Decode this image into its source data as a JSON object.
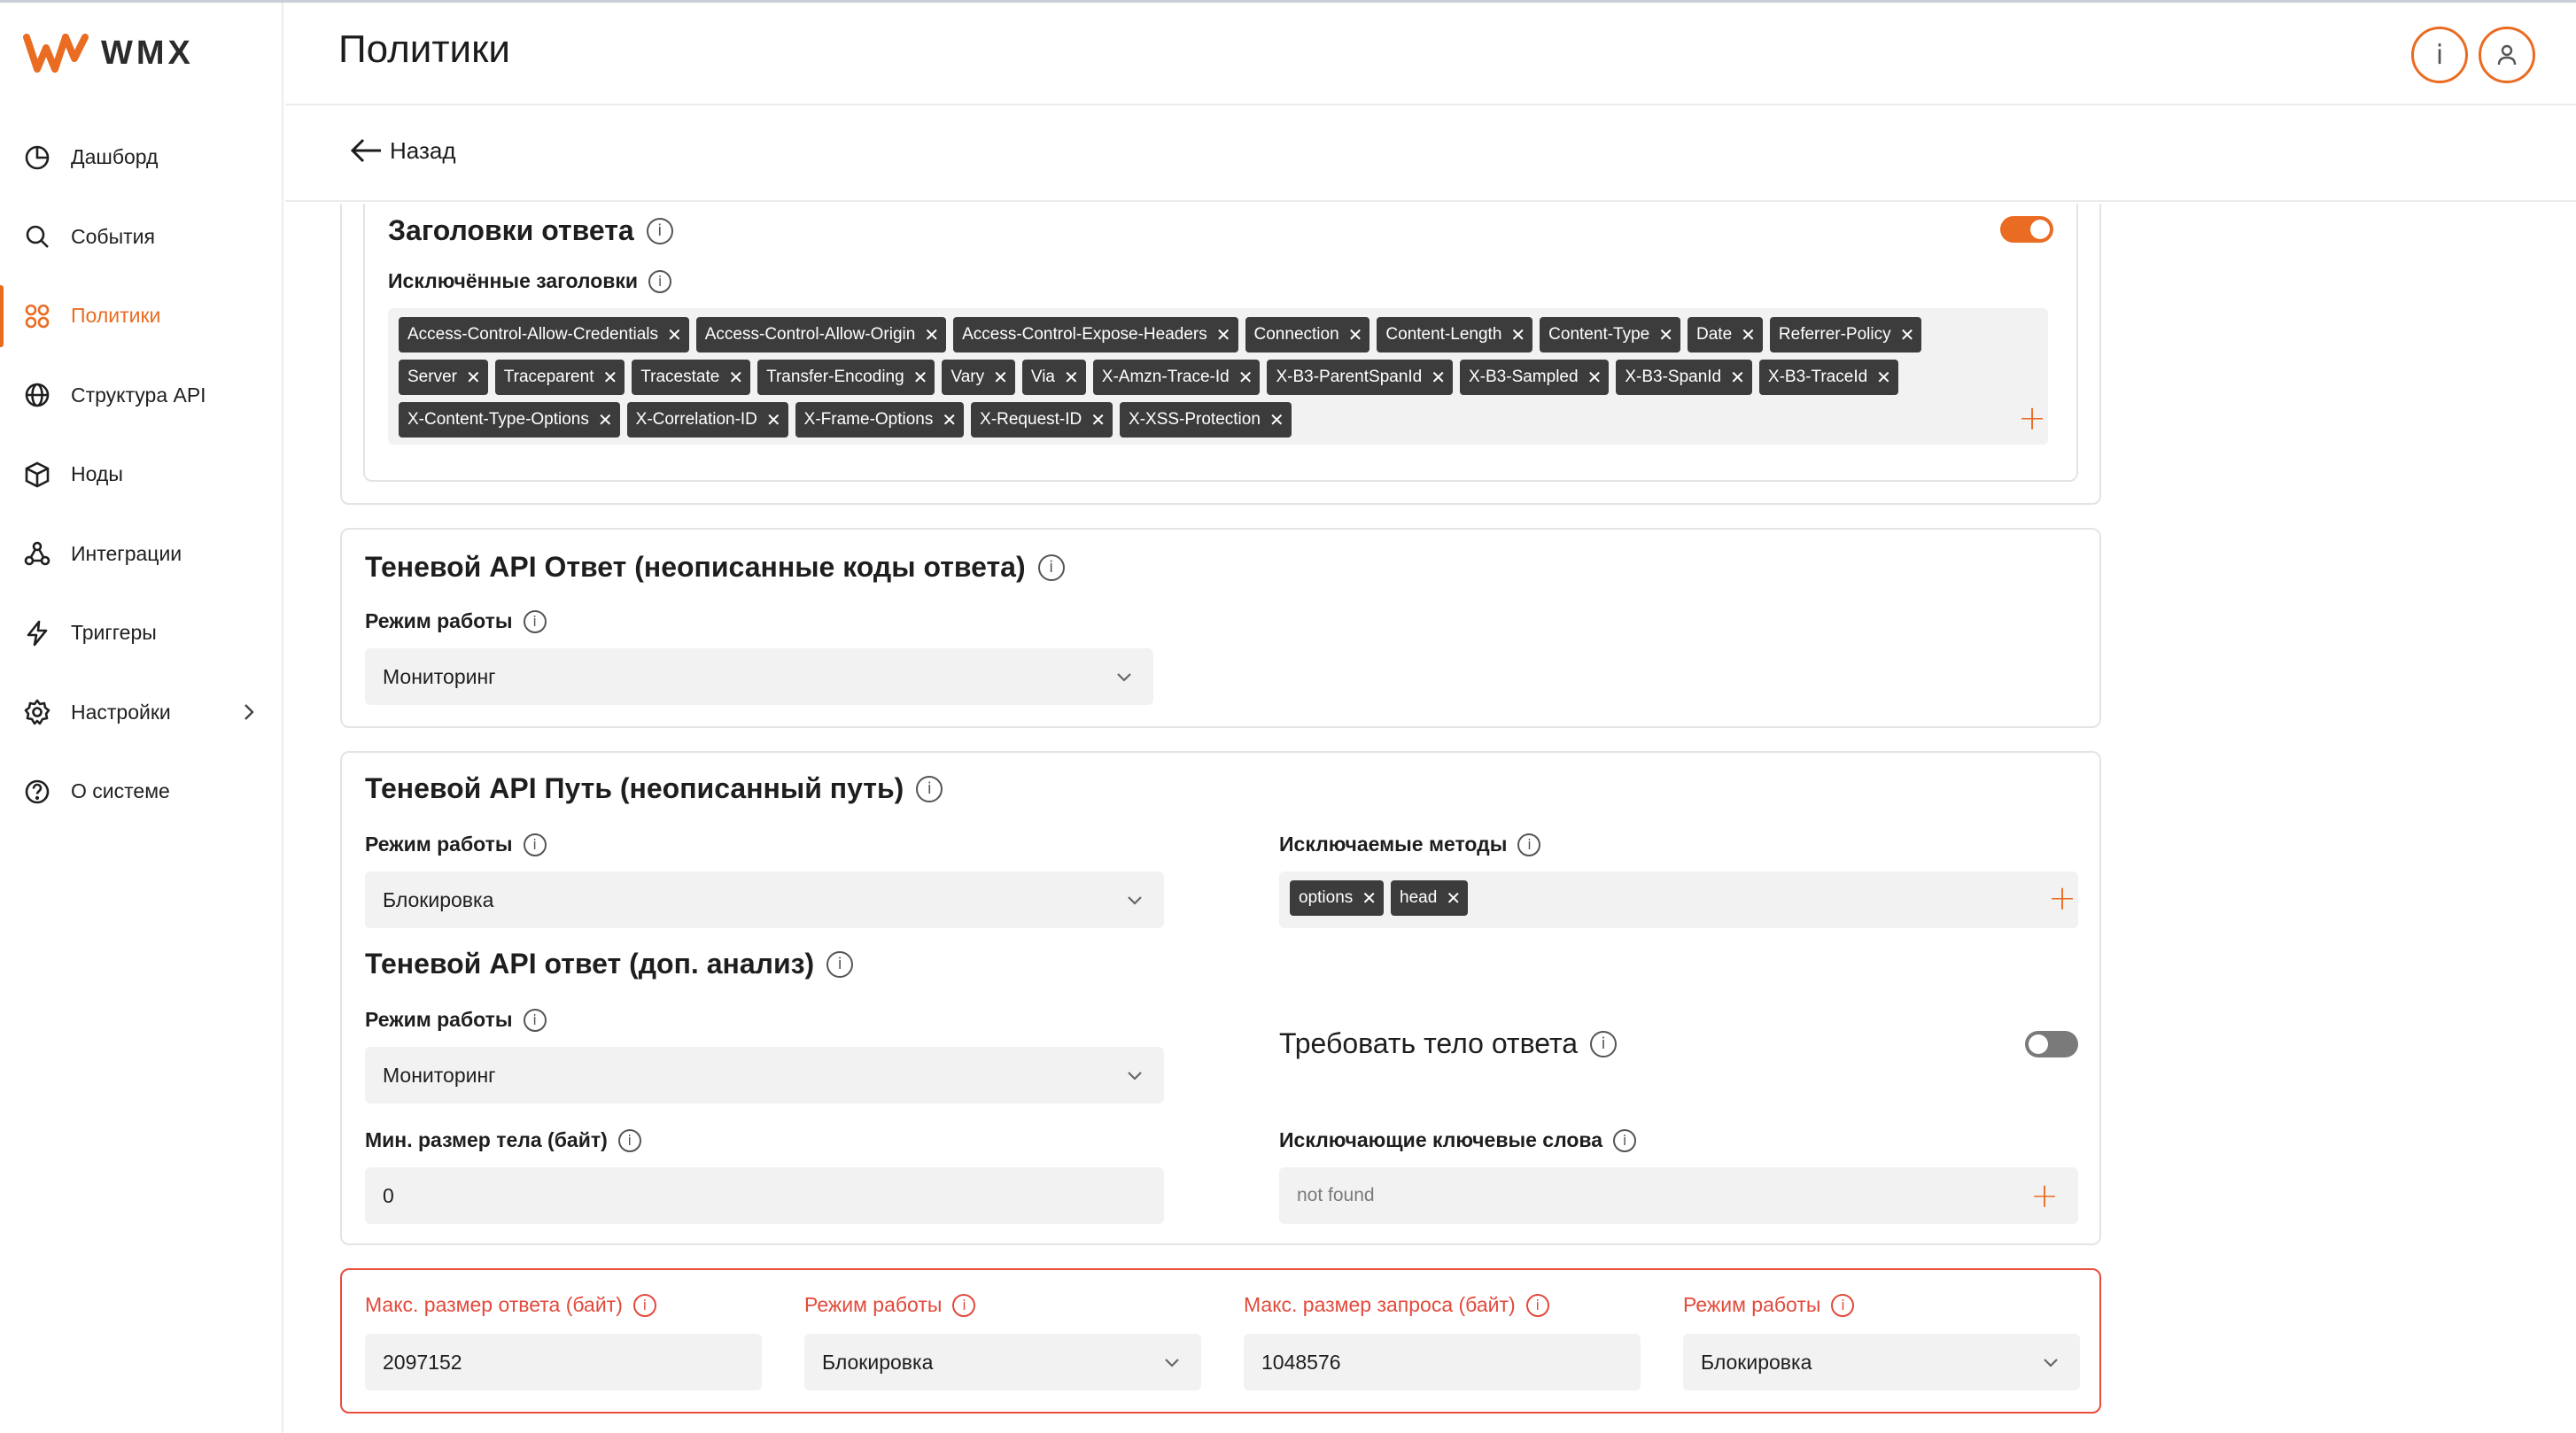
{
  "app": {
    "brand": "WMX",
    "accent": "#ea6b22",
    "error_color": "#e24a3b"
  },
  "sidebar": {
    "items": [
      {
        "label": "Дашборд",
        "icon": "pie-chart-icon"
      },
      {
        "label": "События",
        "icon": "search-icon"
      },
      {
        "label": "Политики",
        "icon": "grid-icon",
        "active": true
      },
      {
        "label": "Структура API",
        "icon": "globe-icon"
      },
      {
        "label": "Ноды",
        "icon": "cube-icon"
      },
      {
        "label": "Интеграции",
        "icon": "webhook-icon"
      },
      {
        "label": "Триггеры",
        "icon": "lightning-icon"
      },
      {
        "label": "Настройки",
        "icon": "gear-icon"
      },
      {
        "label": "О системе",
        "icon": "question-icon"
      }
    ]
  },
  "header": {
    "title": "Политики",
    "info_label": "i"
  },
  "back": {
    "label": "Назад"
  },
  "response_headers": {
    "title": "Заголовки ответа",
    "enabled": true,
    "excluded_label": "Исключённые заголовки",
    "chips": [
      "Access-Control-Allow-Credentials",
      "Access-Control-Allow-Origin",
      "Access-Control-Expose-Headers",
      "Connection",
      "Content-Length",
      "Content-Type",
      "Date",
      "Referrer-Policy",
      "Server",
      "Traceparent",
      "Tracestate",
      "Transfer-Encoding",
      "Vary",
      "Via",
      "X-Amzn-Trace-Id",
      "X-B3-ParentSpanId",
      "X-B3-Sampled",
      "X-B3-SpanId",
      "X-B3-TraceId",
      "X-Content-Type-Options",
      "X-Correlation-ID",
      "X-Frame-Options",
      "X-Request-ID",
      "X-XSS-Protection"
    ]
  },
  "shadow_response": {
    "title": "Теневой API Ответ (неописанные коды ответа)",
    "mode_label": "Режим работы",
    "mode_value": "Мониторинг"
  },
  "shadow_path": {
    "title": "Теневой API Путь (неописанный путь)",
    "mode_label": "Режим работы",
    "mode_value": "Блокировка",
    "methods_label": "Исключаемые методы",
    "methods": [
      "options",
      "head"
    ]
  },
  "shadow_analysis": {
    "title": "Теневой API ответ (доп. анализ)",
    "mode_label": "Режим работы",
    "mode_value": "Мониторинг",
    "require_body_label": "Требовать тело ответа",
    "require_body": false,
    "min_body_label": "Мин. размер тела (байт)",
    "min_body_value": "0",
    "keywords_label": "Исключающие ключевые слова",
    "keywords_placeholder": "not found"
  },
  "limits": {
    "max_response_label": "Макс. размер ответа (байт)",
    "max_response_value": "2097152",
    "mode1_label": "Режим работы",
    "mode1_value": "Блокировка",
    "max_request_label": "Макс. размер запроса (байт)",
    "max_request_value": "1048576",
    "mode2_label": "Режим работы",
    "mode2_value": "Блокировка"
  }
}
